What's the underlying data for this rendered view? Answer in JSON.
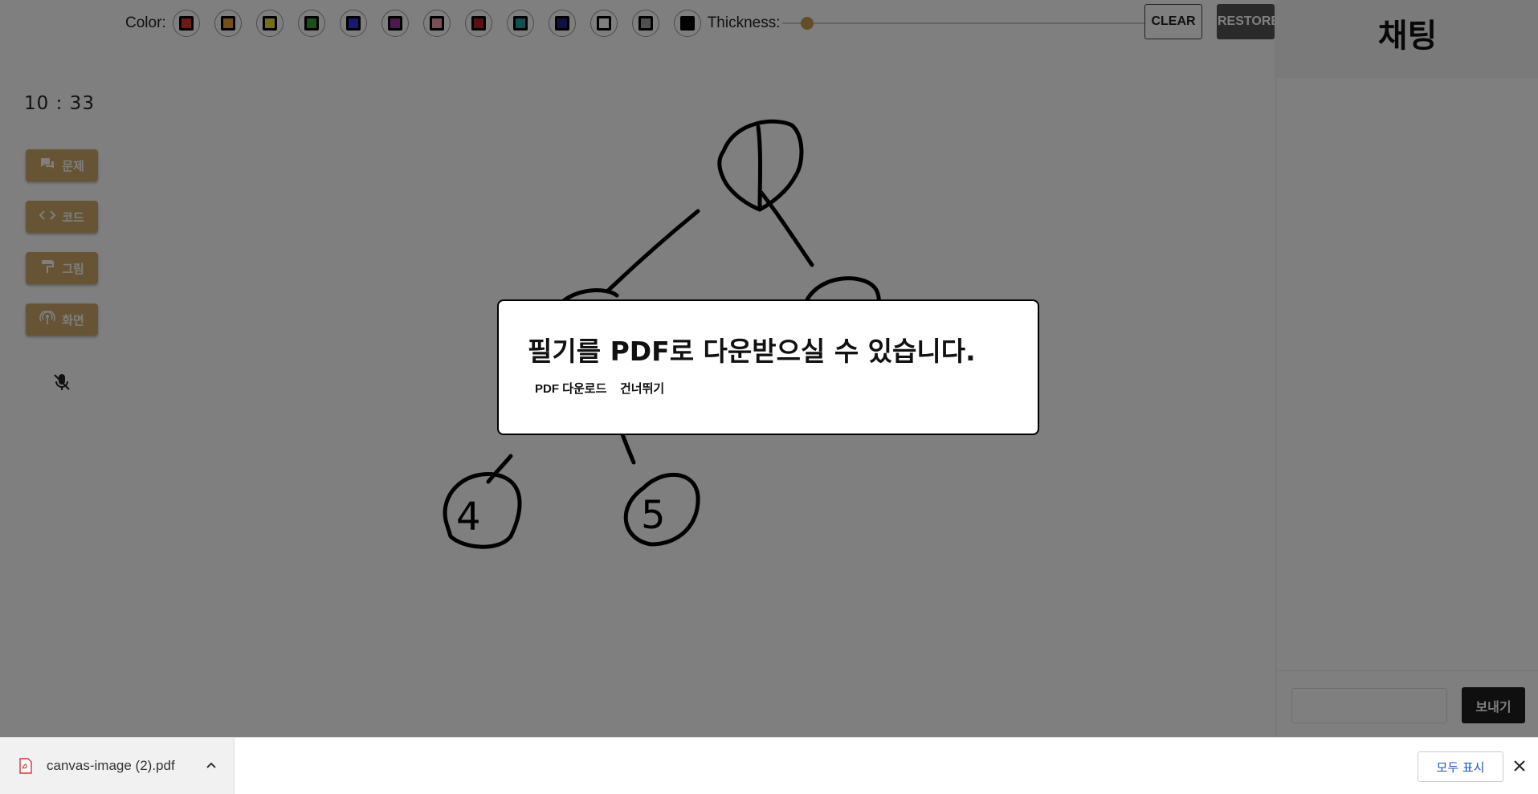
{
  "sidebar": {
    "timer": "10 : 33",
    "buttons": [
      {
        "label": "문제",
        "icon": "chat-bubbles-icon"
      },
      {
        "label": "코드",
        "icon": "code-brackets-icon"
      },
      {
        "label": "그림",
        "icon": "paint-roller-icon"
      },
      {
        "label": "화면",
        "icon": "broadcast-icon"
      }
    ],
    "mic_icon": "mic-muted-icon"
  },
  "toolbar": {
    "color_label": "Color:",
    "swatches": [
      "#e03030",
      "#e8a030",
      "#e8e030",
      "#30a030",
      "#3030e0",
      "#a030a0",
      "#f0a0b0",
      "#b02020",
      "#20a0a0",
      "#202080",
      "#ffffff",
      "#a0a0a0",
      "#000000"
    ],
    "thickness_label": "Thickness:",
    "thickness_fraction": 0.07,
    "clear_label": "CLEAR",
    "restore_label": "RESTORE"
  },
  "canvas": {
    "node_labels": [
      "4",
      "5"
    ]
  },
  "chat": {
    "title": "채팅",
    "send_label": "보내기",
    "input_placeholder": ""
  },
  "modal": {
    "title": "필기를 PDF로 다운받으실 수 있습니다.",
    "pdf_button": "PDF 다운로드",
    "skip_button": "건너뛰기"
  },
  "download_bar": {
    "filename": "canvas-image (2).pdf",
    "show_all": "모두 표시"
  }
}
